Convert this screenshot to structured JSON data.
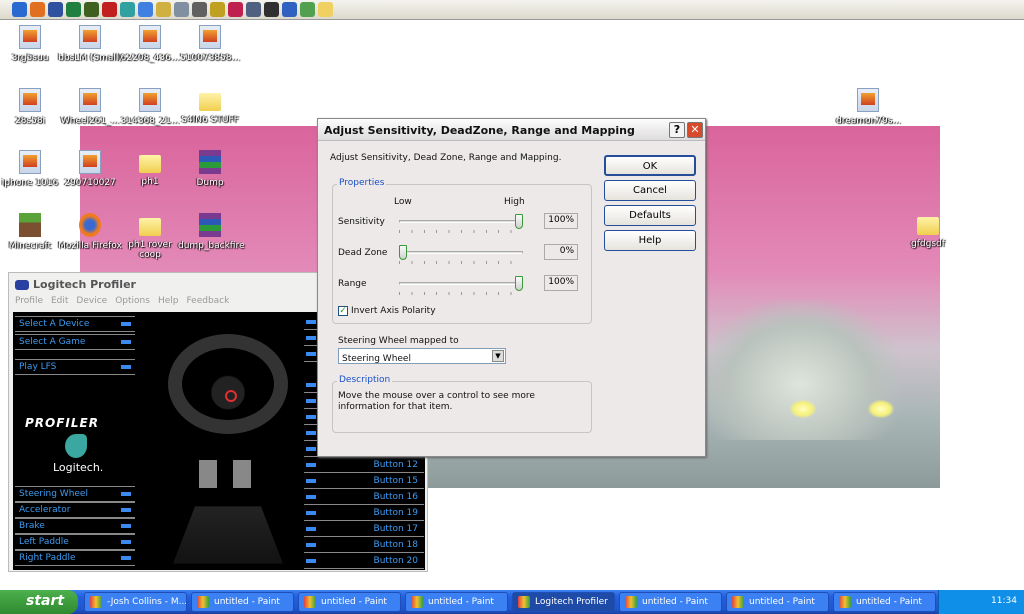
{
  "quicklaunch": {
    "icons": [
      "ie-icon",
      "firefox-icon",
      "app-icon",
      "app-icon",
      "minecraft-icon",
      "ati-icon",
      "app-icon",
      "app-icon",
      "app-icon",
      "app-icon",
      "app-icon",
      "app-icon",
      "app-icon",
      "app-icon",
      "app-icon",
      "app-icon",
      "app-icon",
      "folder-icon"
    ],
    "colors": [
      "#2a6ad0",
      "#e07020",
      "#3050a0",
      "#208040",
      "#406020",
      "#c02020",
      "#30a0a0",
      "#4080e0",
      "#d0b040",
      "#8090a0",
      "#606060",
      "#c0a020",
      "#c02050",
      "#506080",
      "#303030",
      "#3060c0",
      "#50a050",
      "#f0d060"
    ]
  },
  "desktop": {
    "icons": [
      {
        "label": "3rg5suu",
        "type": "file"
      },
      {
        "label": "bbsLM (Small)",
        "type": "file"
      },
      {
        "label": "62208_436...",
        "type": "file"
      },
      {
        "label": "510073858...",
        "type": "file"
      },
      {
        "label": "28s58i",
        "type": "file"
      },
      {
        "label": "Wheel261_...",
        "type": "file"
      },
      {
        "label": "314368_21...",
        "type": "file"
      },
      {
        "label": "S4IN6 STUFF",
        "type": "folder"
      },
      {
        "label": "iphone 1016",
        "type": "file"
      },
      {
        "label": "290710027",
        "type": "file"
      },
      {
        "label": "ph1",
        "type": "folder"
      },
      {
        "label": "Dump",
        "type": "rar"
      },
      {
        "label": "Minecraft",
        "type": "mc"
      },
      {
        "label": "Mozilla Firefox",
        "type": "ff"
      },
      {
        "label": "ph1 rover coop",
        "type": "folder"
      },
      {
        "label": "dump_backfire",
        "type": "rar"
      },
      {
        "label": "dreamon79s...",
        "type": "file"
      },
      {
        "label": "gfdgsdf",
        "type": "folder"
      }
    ]
  },
  "dialog": {
    "title": "Adjust Sensitivity, DeadZone, Range and Mapping",
    "help_btn": "?",
    "close_btn": "✕",
    "intro": "Adjust Sensitivity, Dead Zone, Range and Mapping.",
    "properties_label": "Properties",
    "low": "Low",
    "high": "High",
    "sliders": [
      {
        "label": "Sensitivity",
        "value": "100%",
        "level": 1.0
      },
      {
        "label": "Dead Zone",
        "value": "0%",
        "level": 0.0
      },
      {
        "label": "Range",
        "value": "100%",
        "level": 1.0
      }
    ],
    "invert_label": "Invert Axis Polarity",
    "invert_checked": true,
    "mapped_label": "Steering Wheel mapped to",
    "mapped_value": "Steering Wheel",
    "description_label": "Description",
    "description_text": "Move the mouse over a control to see more information for that item.",
    "buttons": {
      "ok": "OK",
      "cancel": "Cancel",
      "defaults": "Defaults",
      "help": "Help"
    }
  },
  "profiler": {
    "title": "Logitech Profiler",
    "menu": [
      "Profile",
      "Edit",
      "Device",
      "Options",
      "Help",
      "Feedback"
    ],
    "top_items": [
      "Select A Device",
      "Select A Game",
      "Play LFS"
    ],
    "logo_text": "PROFILER",
    "brand": "Logitech.",
    "axis_items": [
      "Steering Wheel",
      "Accelerator",
      "Brake",
      "Left Paddle",
      "Right Paddle"
    ],
    "buttons": [
      "Button 12",
      "Button 15",
      "Button 16",
      "Button 19",
      "Button 17",
      "Button 18",
      "Button 20"
    ]
  },
  "taskbar": {
    "start": "start",
    "items": [
      {
        "label": "-Josh Collins - M..."
      },
      {
        "label": "untitled - Paint"
      },
      {
        "label": "untitled - Paint"
      },
      {
        "label": "untitled - Paint"
      },
      {
        "label": "Logitech Profiler",
        "active": true
      },
      {
        "label": "untitled - Paint"
      },
      {
        "label": "untitled - Paint"
      },
      {
        "label": "untitled - Paint"
      }
    ],
    "clock": "11:34"
  }
}
